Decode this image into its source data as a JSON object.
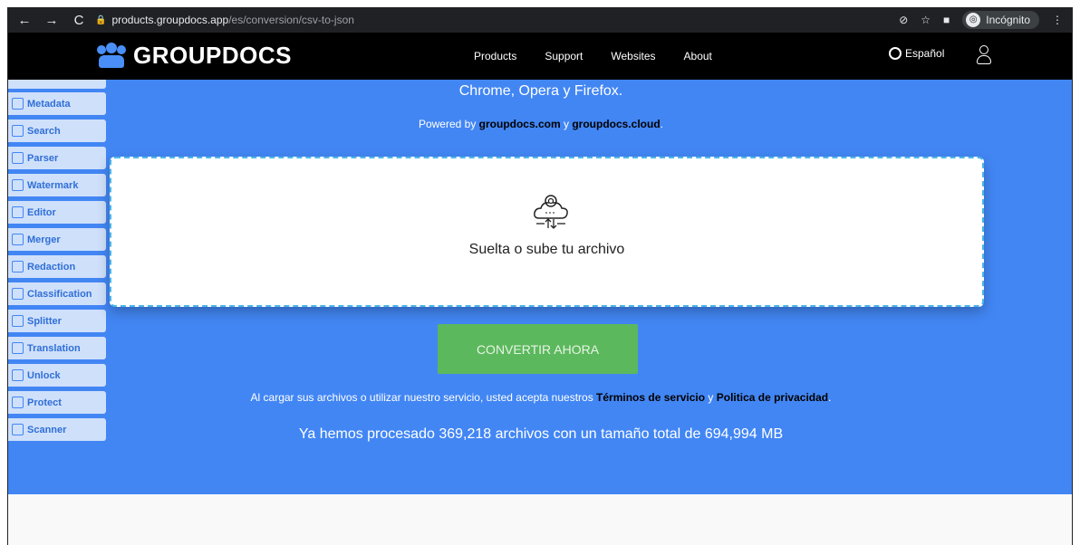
{
  "browser": {
    "url_host": "products.groupdocs.app",
    "url_path": "/es/conversion/csv-to-json",
    "incognito_label": "Incógnito"
  },
  "header": {
    "brand": "GROUPDOCS",
    "nav": [
      "Products",
      "Support",
      "Websites",
      "About"
    ],
    "language": "Español"
  },
  "hero": {
    "subtitle": "Chrome, Opera y Firefox.",
    "powered_prefix": "Powered by ",
    "powered_link1": "groupdocs.com",
    "powered_mid": " y ",
    "powered_link2": "groupdocs.cloud",
    "powered_suffix": "."
  },
  "sidebar": {
    "items": [
      {
        "label": "Metadata",
        "icon": "metadata-icon"
      },
      {
        "label": "Search",
        "icon": "search-icon"
      },
      {
        "label": "Parser",
        "icon": "parser-icon"
      },
      {
        "label": "Watermark",
        "icon": "watermark-icon"
      },
      {
        "label": "Editor",
        "icon": "editor-icon"
      },
      {
        "label": "Merger",
        "icon": "merger-icon"
      },
      {
        "label": "Redaction",
        "icon": "redaction-icon"
      },
      {
        "label": "Classification",
        "icon": "classification-icon"
      },
      {
        "label": "Splitter",
        "icon": "splitter-icon"
      },
      {
        "label": "Translation",
        "icon": "translation-icon"
      },
      {
        "label": "Unlock",
        "icon": "unlock-icon"
      },
      {
        "label": "Protect",
        "icon": "lock-icon"
      },
      {
        "label": "Scanner",
        "icon": "scanner-icon"
      }
    ]
  },
  "upload": {
    "drop_text": "Suelta o sube tu archivo"
  },
  "convert_label": "CONVERTIR AHORA",
  "terms": {
    "prefix": "Al cargar sus archivos o utilizar nuestro servicio, usted acepta nuestros ",
    "link1": "Términos de servicio",
    "mid": " y ",
    "link2": "Politica de privacidad",
    "suffix": "."
  },
  "stats": "Ya hemos procesado 369,218 archivos con un tamaño total de 694,994 MB",
  "colors": {
    "blue": "#4286f4",
    "green_button": "#5cb85c",
    "sidebar_bg": "#cfe0fb"
  }
}
